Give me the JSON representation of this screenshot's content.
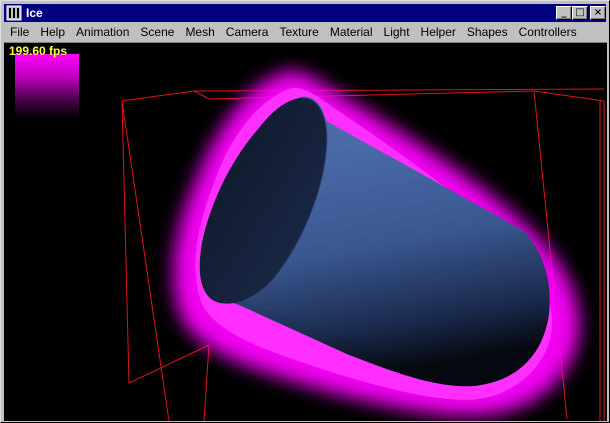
{
  "window": {
    "title": "Ice",
    "minimize_glyph": "_",
    "maximize_glyph": "□",
    "close_glyph": "×"
  },
  "menu": [
    {
      "label": "File"
    },
    {
      "label": "Help"
    },
    {
      "label": "Animation"
    },
    {
      "label": "Scene"
    },
    {
      "label": "Mesh"
    },
    {
      "label": "Camera"
    },
    {
      "label": "Texture"
    },
    {
      "label": "Material"
    },
    {
      "label": "Light"
    },
    {
      "label": "Helper"
    },
    {
      "label": "Shapes"
    },
    {
      "label": "Controllers"
    }
  ],
  "viewport": {
    "fps_text": "199.60 fps",
    "colors": {
      "background": "#000000",
      "fps_text": "#ffff40",
      "glow": "#ff00ff",
      "cylinder": "#3a5a96",
      "cylinder_cap": "#0f1a2e",
      "bounding_box": "#ff1a1a"
    }
  }
}
